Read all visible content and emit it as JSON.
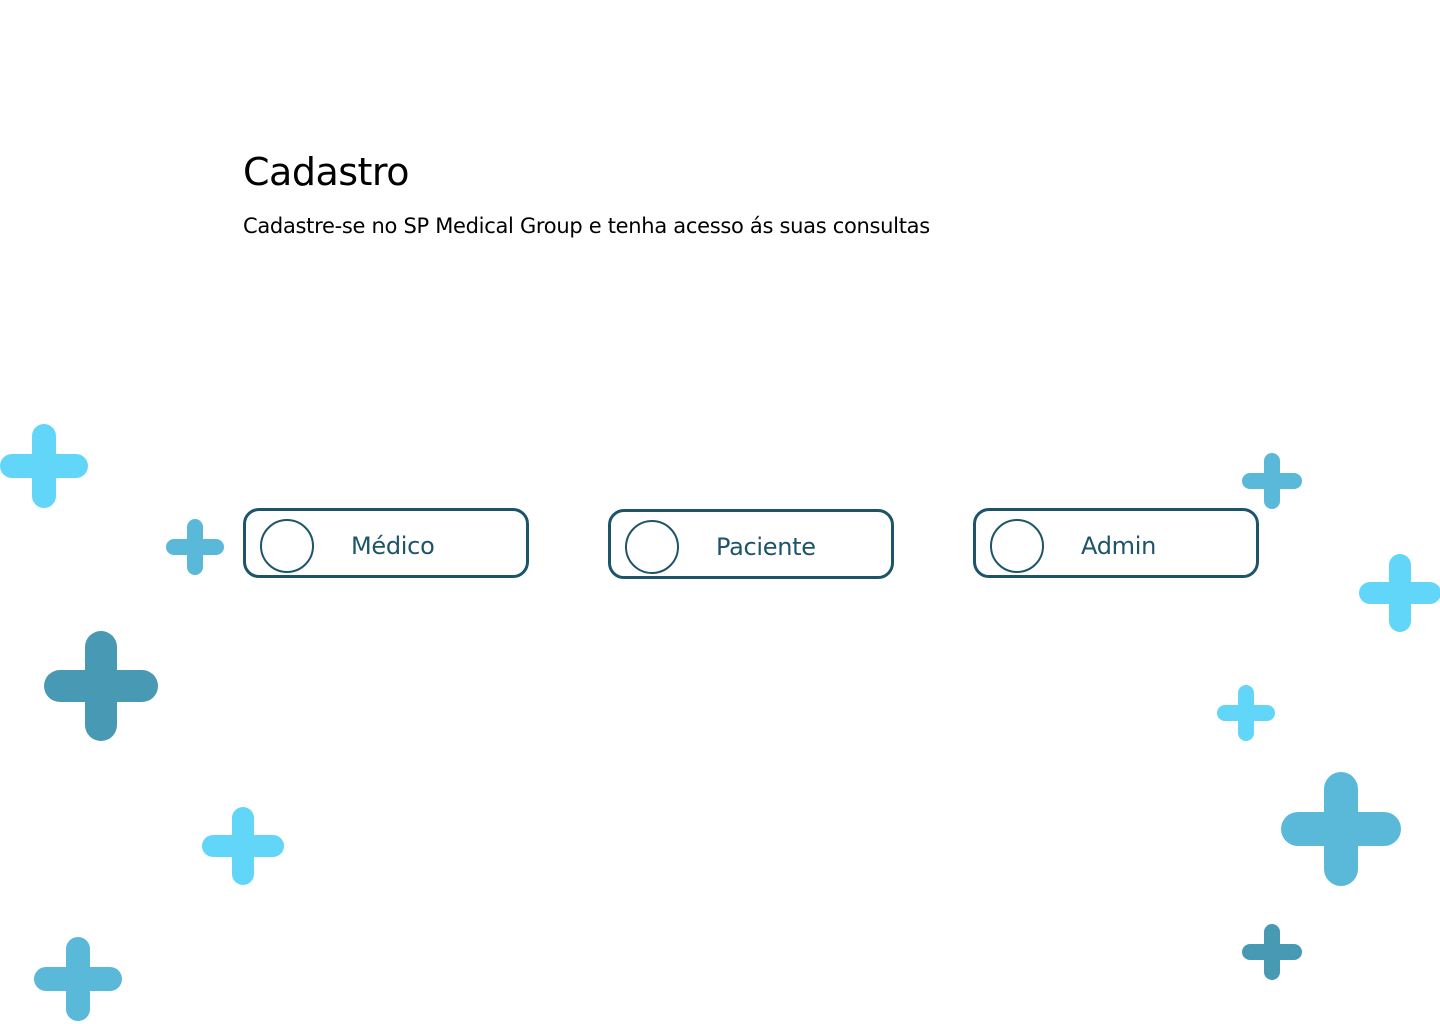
{
  "page": {
    "title": "Cadastro",
    "subtitle": "Cadastre-se no SP Medical Group e tenha acesso ás suas consultas"
  },
  "role_options": [
    {
      "label": "Médico",
      "selected": false
    },
    {
      "label": "Paciente",
      "selected": false
    },
    {
      "label": "Admin",
      "selected": false
    }
  ],
  "colors": {
    "accent": "#1d5469",
    "decor_light": "#62d6f8",
    "decor_mid": "#5ab8d8",
    "decor_dark": "#4899b3"
  },
  "decorations": {
    "icon": "plus-icon"
  }
}
